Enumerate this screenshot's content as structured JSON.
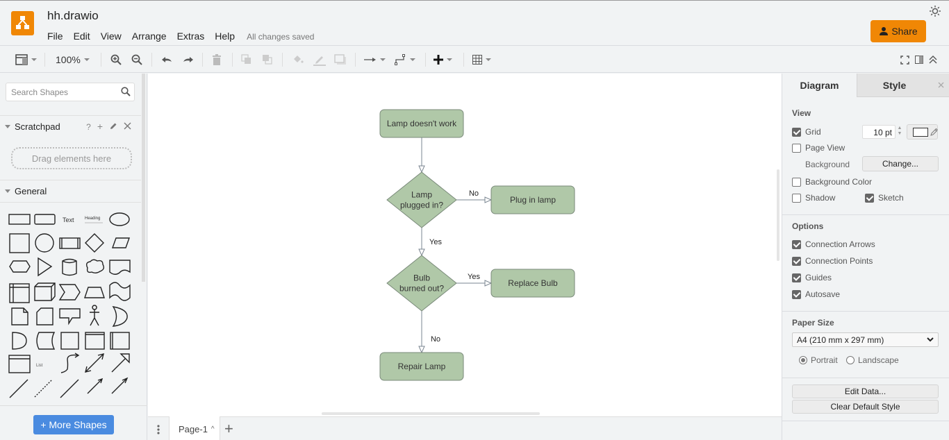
{
  "app": {
    "title": "hh.drawio",
    "save_status": "All changes saved",
    "share_label": "Share",
    "logo": "drawio-logo-icon",
    "theme_icon": "sun-icon"
  },
  "menu": [
    {
      "label": "File"
    },
    {
      "label": "Edit"
    },
    {
      "label": "View"
    },
    {
      "label": "Arrange"
    },
    {
      "label": "Extras"
    },
    {
      "label": "Help"
    }
  ],
  "toolbar": {
    "zoom_level": "100%",
    "buttons": [
      "format-panel-icon",
      "zoom-in-icon",
      "zoom-out-icon",
      "undo-icon",
      "redo-icon",
      "delete-icon",
      "to-front-icon",
      "to-back-icon",
      "fill-color-icon",
      "line-color-icon",
      "shadow-icon",
      "connection-icon",
      "waypoints-icon",
      "insert-icon",
      "table-icon",
      "fullscreen-icon",
      "toggle-panel-icon",
      "collapse-icon"
    ]
  },
  "sidebar": {
    "search_placeholder": "Search Shapes",
    "scratchpad_label": "Scratchpad",
    "scratchpad_help": "?",
    "scratchpad_drop_hint": "Drag elements here",
    "general_label": "General",
    "text_shape_label": "Text",
    "heading_shape_label": "Heading",
    "list_shape_label": "List",
    "more_shapes_label": "+ More Shapes"
  },
  "diagram": {
    "colors": {
      "fill": "#b0c8a8",
      "stroke": "#7a8a7a",
      "edge": "#7a8590"
    },
    "nodes": [
      {
        "id": "start",
        "type": "rounded-rect",
        "label": [
          "Lamp doesn't work"
        ]
      },
      {
        "id": "q1",
        "type": "diamond",
        "label": [
          "Lamp",
          "plugged in?"
        ]
      },
      {
        "id": "plug",
        "type": "rounded-rect",
        "label": [
          "Plug in lamp"
        ]
      },
      {
        "id": "q2",
        "type": "diamond",
        "label": [
          "Bulb",
          "burned out?"
        ]
      },
      {
        "id": "replace",
        "type": "rounded-rect",
        "label": [
          "Replace Bulb"
        ]
      },
      {
        "id": "repair",
        "type": "rounded-rect",
        "label": [
          "Repair Lamp"
        ]
      }
    ],
    "edges": [
      {
        "from": "start",
        "to": "q1",
        "label": ""
      },
      {
        "from": "q1",
        "to": "plug",
        "label": "No"
      },
      {
        "from": "q1",
        "to": "q2",
        "label": "Yes"
      },
      {
        "from": "q2",
        "to": "replace",
        "label": "Yes"
      },
      {
        "from": "q2",
        "to": "repair",
        "label": "No"
      }
    ]
  },
  "pages": {
    "current": "Page-1"
  },
  "format_panel": {
    "tabs": {
      "diagram": "Diagram",
      "style": "Style"
    },
    "view": {
      "heading": "View",
      "grid_label": "Grid",
      "grid_checked": true,
      "grid_size": "10 pt",
      "page_view_label": "Page View",
      "page_view_checked": false,
      "background_label": "Background",
      "change_button": "Change...",
      "background_color_label": "Background Color",
      "background_color_checked": false,
      "shadow_label": "Shadow",
      "shadow_checked": false,
      "sketch_label": "Sketch",
      "sketch_checked": true
    },
    "options": {
      "heading": "Options",
      "items": [
        {
          "label": "Connection Arrows",
          "checked": true
        },
        {
          "label": "Connection Points",
          "checked": true
        },
        {
          "label": "Guides",
          "checked": true
        },
        {
          "label": "Autosave",
          "checked": true
        }
      ]
    },
    "paper": {
      "heading": "Paper Size",
      "selected": "A4 (210 mm x 297 mm)",
      "portrait_label": "Portrait",
      "portrait_selected": true,
      "landscape_label": "Landscape",
      "landscape_selected": false
    },
    "edit_data_button": "Edit Data...",
    "clear_style_button": "Clear Default Style"
  }
}
